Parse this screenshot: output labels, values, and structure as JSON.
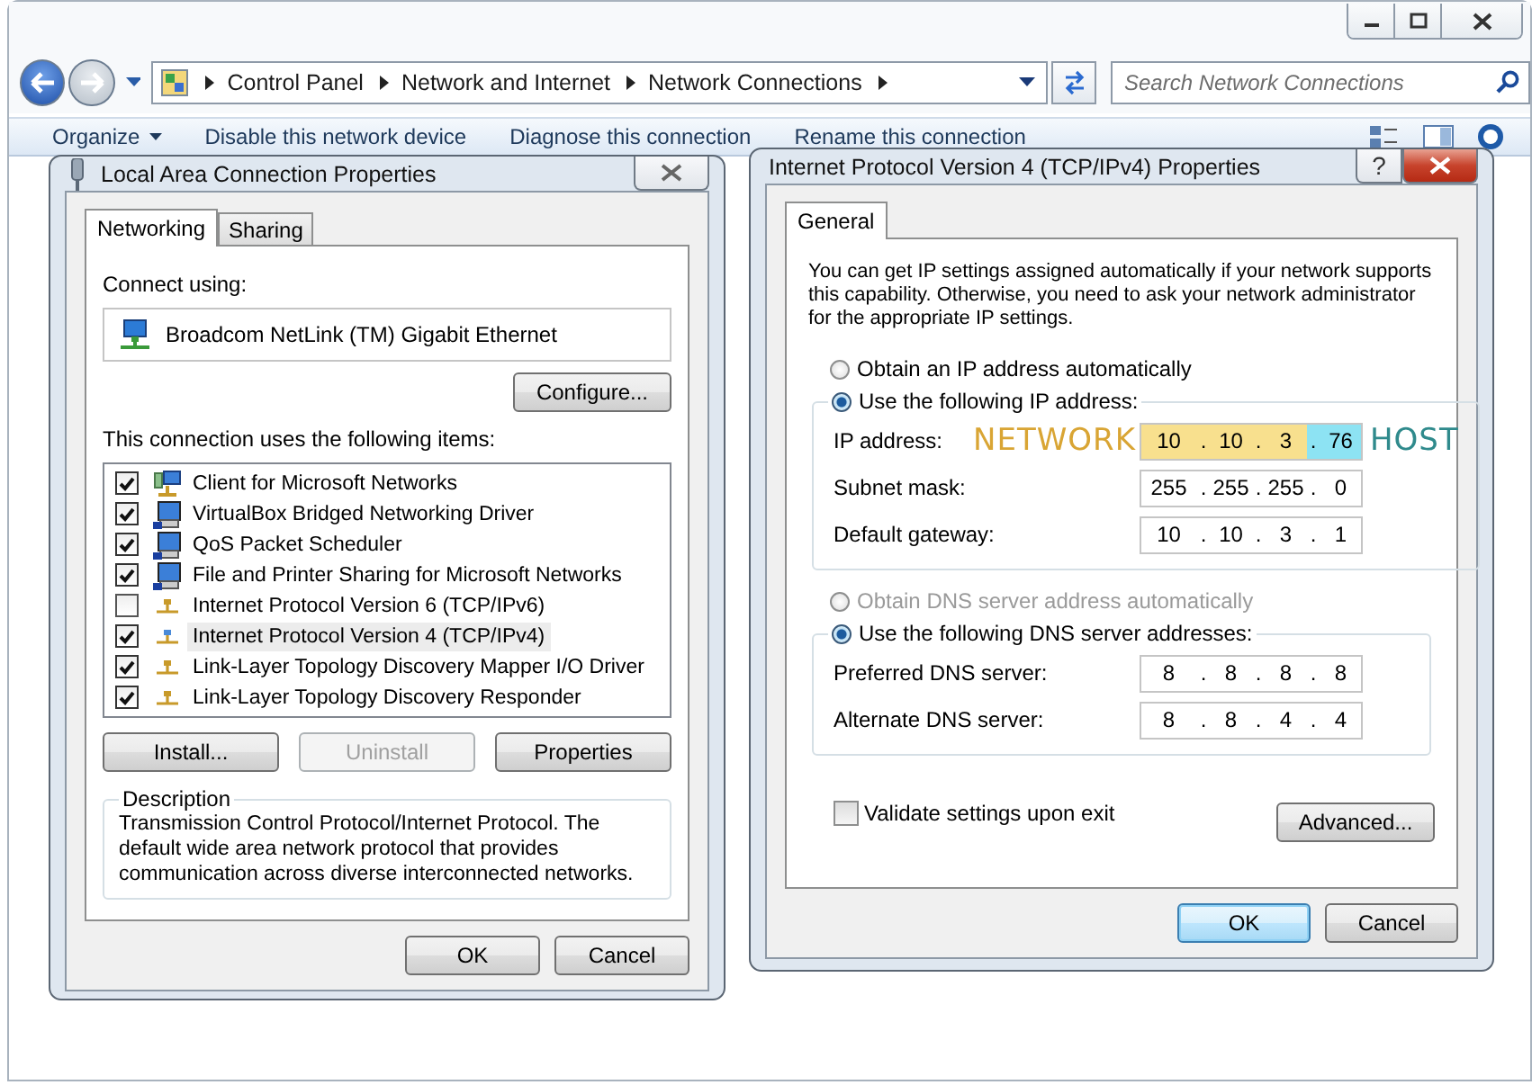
{
  "explorer": {
    "breadcrumb": [
      "Control Panel",
      "Network and Internet",
      "Network Connections"
    ],
    "search": {
      "placeholder": "Search Network Connections"
    },
    "toolbar": [
      {
        "label": "Organize",
        "kind": "menu"
      },
      {
        "label": "Disable this network device",
        "kind": "command"
      },
      {
        "label": "Diagnose this connection",
        "kind": "command"
      },
      {
        "label": "Rename this connection",
        "kind": "command"
      }
    ]
  },
  "lan_dialog": {
    "title": "Local Area Connection Properties",
    "tabs": [
      {
        "label": "Networking",
        "selected": true
      },
      {
        "label": "Sharing",
        "selected": false
      }
    ],
    "connect_using_label": "Connect using:",
    "adapter": "Broadcom NetLink (TM) Gigabit Ethernet",
    "configure_button": "Configure...",
    "items_label": "This connection uses the following items:",
    "items": [
      {
        "label": "Client for Microsoft Networks",
        "kind": "client",
        "checked": true,
        "selected": false
      },
      {
        "label": "VirtualBox Bridged Networking Driver",
        "kind": "service",
        "checked": true,
        "selected": false
      },
      {
        "label": "QoS Packet Scheduler",
        "kind": "service",
        "checked": true,
        "selected": false
      },
      {
        "label": "File and Printer Sharing for Microsoft Networks",
        "kind": "service",
        "checked": true,
        "selected": false
      },
      {
        "label": "Internet Protocol Version 6 (TCP/IPv6)",
        "kind": "protocol",
        "checked": false,
        "selected": false
      },
      {
        "label": "Internet Protocol Version 4 (TCP/IPv4)",
        "kind": "protocol",
        "checked": true,
        "selected": true
      },
      {
        "label": "Link-Layer Topology Discovery Mapper I/O Driver",
        "kind": "protocol",
        "checked": true,
        "selected": false
      },
      {
        "label": "Link-Layer Topology Discovery Responder",
        "kind": "protocol",
        "checked": true,
        "selected": false
      }
    ],
    "item_buttons": [
      {
        "label": "Install...",
        "disabled": false
      },
      {
        "label": "Uninstall",
        "disabled": true
      },
      {
        "label": "Properties",
        "disabled": false
      }
    ],
    "description": {
      "title": "Description",
      "text": "Transmission Control Protocol/Internet Protocol. The default wide area network protocol that provides communication across diverse interconnected networks."
    },
    "footer_buttons": [
      {
        "label": "OK",
        "default": false
      },
      {
        "label": "Cancel",
        "default": false
      }
    ]
  },
  "ipv4_dialog": {
    "title": "Internet Protocol Version 4 (TCP/IPv4) Properties",
    "help_button": "?",
    "tabs": [
      {
        "label": "General",
        "selected": true
      }
    ],
    "intro": "You can get IP settings assigned automatically if your network supports this capability. Otherwise, you need to ask your network administrator for the appropriate IP settings.",
    "separator": ".",
    "ip_modes": [
      {
        "label": "Obtain an IP address automatically",
        "selected": false,
        "disabled": false
      },
      {
        "label": "Use the following IP address:",
        "selected": true,
        "disabled": false
      }
    ],
    "ip_fields": [
      {
        "label": "IP address:",
        "octets": [
          {
            "value": "10",
            "kind": "network"
          },
          {
            "value": "10",
            "kind": "network"
          },
          {
            "value": "3",
            "kind": "network"
          },
          {
            "value": "76",
            "kind": "host"
          }
        ],
        "annotations": [
          {
            "kind": "network",
            "text": "NETWORK"
          },
          {
            "kind": "host",
            "text": "HOST"
          }
        ]
      },
      {
        "label": "Subnet mask:",
        "octets": [
          {
            "value": "255"
          },
          {
            "value": "255"
          },
          {
            "value": "255"
          },
          {
            "value": "0"
          }
        ]
      },
      {
        "label": "Default gateway:",
        "octets": [
          {
            "value": "10"
          },
          {
            "value": "10"
          },
          {
            "value": "3"
          },
          {
            "value": "1"
          }
        ]
      }
    ],
    "dns_modes": [
      {
        "label": "Obtain DNS server address automatically",
        "selected": false,
        "disabled": true
      },
      {
        "label": "Use the following DNS server addresses:",
        "selected": true,
        "disabled": false
      }
    ],
    "dns_fields": [
      {
        "label": "Preferred DNS server:",
        "octets": [
          {
            "value": "8"
          },
          {
            "value": "8"
          },
          {
            "value": "8"
          },
          {
            "value": "8"
          }
        ]
      },
      {
        "label": "Alternate DNS server:",
        "octets": [
          {
            "value": "8"
          },
          {
            "value": "8"
          },
          {
            "value": "4"
          },
          {
            "value": "4"
          }
        ]
      }
    ],
    "validate": {
      "label": "Validate settings upon exit",
      "checked": false
    },
    "advanced_button": "Advanced...",
    "footer_buttons": [
      {
        "label": "OK",
        "default": true
      },
      {
        "label": "Cancel",
        "default": false
      }
    ]
  }
}
